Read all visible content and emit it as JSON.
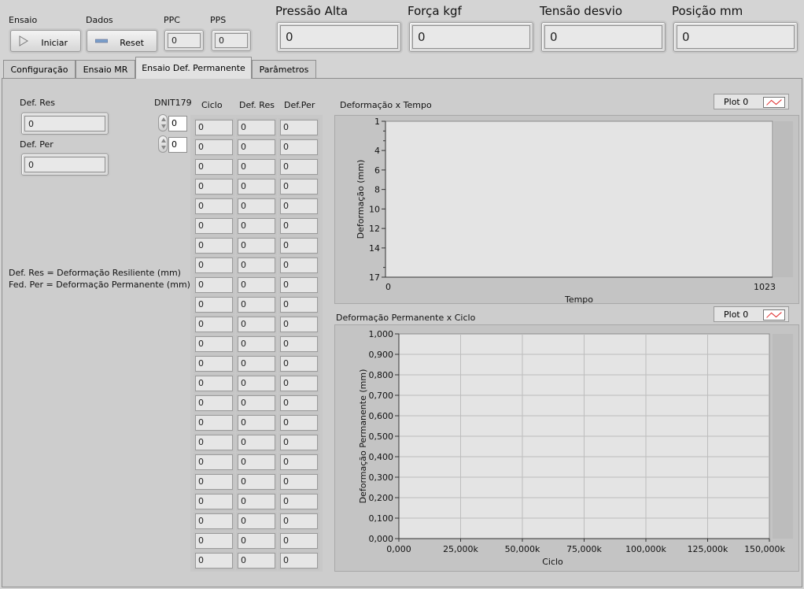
{
  "header": {
    "ensaio_label": "Ensaio",
    "dados_label": "Dados",
    "iniciar_label": "Iniciar",
    "reset_label": "Reset",
    "ppc_label": "PPC",
    "ppc_value": "0",
    "pps_label": "PPS",
    "pps_value": "0",
    "indicators": [
      {
        "label": "Pressão Alta",
        "value": "0"
      },
      {
        "label": "Força kgf",
        "value": "0"
      },
      {
        "label": "Tensão desvio",
        "value": "0"
      },
      {
        "label": "Posição mm",
        "value": "0"
      }
    ]
  },
  "tabs": [
    {
      "label": "Configuração"
    },
    {
      "label": "Ensaio MR"
    },
    {
      "label": "Ensaio Def. Permanente"
    },
    {
      "label": "Parâmetros"
    }
  ],
  "active_tab": "Ensaio Def. Permanente",
  "left": {
    "def_res_label": "Def. Res",
    "def_res_value": "0",
    "def_per_label": "Def. Per",
    "def_per_value": "0",
    "legend_line1": "Def. Res = Deformação Resiliente (mm)",
    "legend_line2": "Fed. Per = Deformação Permanente (mm)"
  },
  "dnit": {
    "label": "DNIT179",
    "value1": "0",
    "value2": "0"
  },
  "table": {
    "headers": [
      "Ciclo",
      "Def. Res",
      "Def.Per"
    ],
    "rows": [
      [
        "0",
        "0",
        "0"
      ],
      [
        "0",
        "0",
        "0"
      ],
      [
        "0",
        "0",
        "0"
      ],
      [
        "0",
        "0",
        "0"
      ],
      [
        "0",
        "0",
        "0"
      ],
      [
        "0",
        "0",
        "0"
      ],
      [
        "0",
        "0",
        "0"
      ],
      [
        "0",
        "0",
        "0"
      ],
      [
        "0",
        "0",
        "0"
      ],
      [
        "0",
        "0",
        "0"
      ],
      [
        "0",
        "0",
        "0"
      ],
      [
        "0",
        "0",
        "0"
      ],
      [
        "0",
        "0",
        "0"
      ],
      [
        "0",
        "0",
        "0"
      ],
      [
        "0",
        "0",
        "0"
      ],
      [
        "0",
        "0",
        "0"
      ],
      [
        "0",
        "0",
        "0"
      ],
      [
        "0",
        "0",
        "0"
      ],
      [
        "0",
        "0",
        "0"
      ],
      [
        "0",
        "0",
        "0"
      ],
      [
        "0",
        "0",
        "0"
      ],
      [
        "0",
        "0",
        "0"
      ],
      [
        "0",
        "0",
        "0"
      ]
    ]
  },
  "chart_data": [
    {
      "type": "line",
      "title": "Deformação x Tempo",
      "xlabel": "Tempo",
      "ylabel": "Deformação (mm)",
      "legend": "Plot 0",
      "xlim": [
        0,
        1023
      ],
      "ylim": [
        1,
        17
      ],
      "y_reversed": true,
      "x_ticks": [
        "0",
        "1023"
      ],
      "y_ticks": [
        "1",
        "4",
        "6",
        "8",
        "10",
        "12",
        "14",
        "17"
      ],
      "y_tick_values": [
        1,
        4,
        6,
        8,
        10,
        12,
        14,
        17
      ],
      "grid": false,
      "series": [
        {
          "values": []
        }
      ]
    },
    {
      "type": "line",
      "title": "Deformação Permanente x Ciclo",
      "xlabel": "Ciclo",
      "ylabel": "Deformação Permanente (mm)",
      "legend": "Plot 0",
      "xlim": [
        0,
        150000
      ],
      "ylim": [
        0,
        1
      ],
      "x_ticks": [
        "0,000",
        "25,000k",
        "50,000k",
        "75,000k",
        "100,000k",
        "125,000k",
        "150,000k"
      ],
      "y_ticks": [
        "0,000",
        "0,100",
        "0,200",
        "0,300",
        "0,400",
        "0,500",
        "0,600",
        "0,700",
        "0,800",
        "0,900",
        "1,000"
      ],
      "grid": true,
      "series": [
        {
          "values": []
        }
      ]
    }
  ],
  "colors": {
    "plot_line": "#e03030",
    "plot_bg": "#e4e4e4",
    "window_bg": "#d4d4d4"
  }
}
